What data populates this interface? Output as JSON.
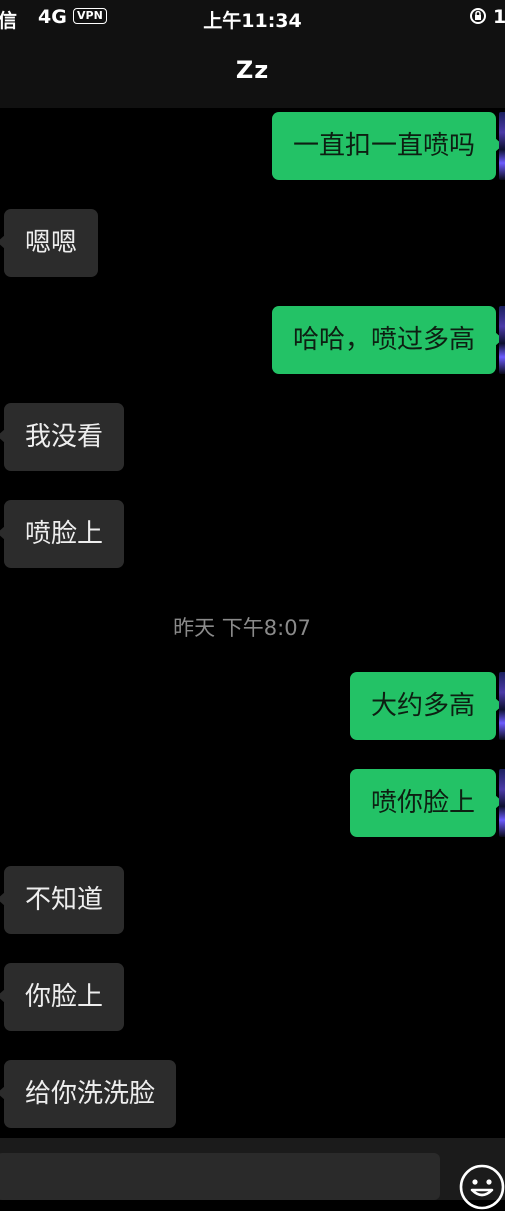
{
  "status_bar": {
    "carrier": "信",
    "network": "4G",
    "vpn": "VPN",
    "time": "上午11:34",
    "battery": "1"
  },
  "nav": {
    "title": "Zz"
  },
  "messages": [
    {
      "side": "out",
      "text": "一直扣一直喷吗"
    },
    {
      "side": "in",
      "text": "嗯嗯"
    },
    {
      "side": "out",
      "text": "哈哈，喷过多高"
    },
    {
      "side": "in",
      "text": "我没看"
    },
    {
      "side": "in",
      "text": "喷脸上"
    },
    {
      "timestamp": "昨天 下午8:07"
    },
    {
      "side": "out",
      "text": "大约多高"
    },
    {
      "side": "out",
      "text": "喷你脸上"
    },
    {
      "side": "in",
      "text": "不知道"
    },
    {
      "side": "in",
      "text": "你脸上"
    },
    {
      "side": "in",
      "text": "给你洗洗脸"
    }
  ],
  "input_bar": {
    "emoji_icon": "emoji-icon"
  }
}
